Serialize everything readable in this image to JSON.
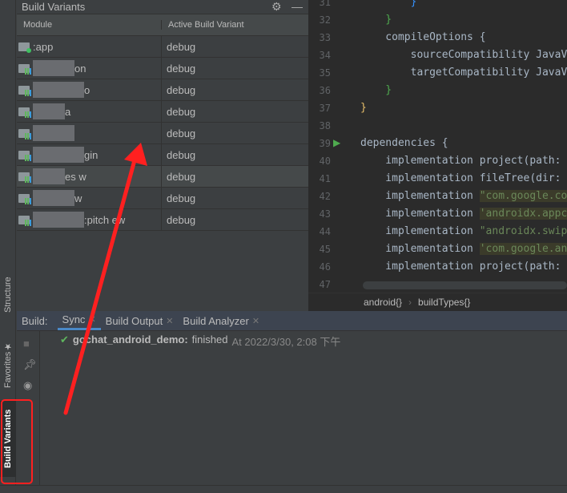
{
  "left_strip": {
    "structure": "Structure",
    "favorites": "Favorites",
    "build_variants": "Build Variants"
  },
  "build_variants": {
    "title": "Build Variants",
    "columns": [
      "Module",
      "Active Build Variant"
    ],
    "rows": [
      {
        "module": ":app",
        "variant": "debug",
        "icon": "app-module"
      },
      {
        "module": "on",
        "variant": "debug",
        "icon": "library-module"
      },
      {
        "module": "o",
        "variant": "debug",
        "icon": "library-module"
      },
      {
        "module": "a",
        "variant": "debug",
        "icon": "library-module"
      },
      {
        "module": "",
        "variant": "debug",
        "icon": "library-module"
      },
      {
        "module": "gin",
        "variant": "debug",
        "icon": "library-module"
      },
      {
        "module": "es w",
        "variant": "debug",
        "icon": "library-module"
      },
      {
        "module": "w",
        "variant": "debug",
        "icon": "library-module"
      },
      {
        "module": ":pitch ew",
        "variant": "debug",
        "icon": "library-module"
      }
    ]
  },
  "editor": {
    "line_numbers": [
      "31",
      "32",
      "33",
      "34",
      "35",
      "36",
      "37",
      "38",
      "39",
      "40",
      "41",
      "42",
      "43",
      "44",
      "45",
      "46",
      "47"
    ],
    "lines": [
      {
        "t": "        }",
        "c": "bb"
      },
      {
        "t": "    }",
        "c": "bg"
      },
      {
        "t": "    compileOptions {"
      },
      {
        "t": "        sourceCompatibility JavaV"
      },
      {
        "t": "        targetCompatibility JavaV"
      },
      {
        "t": "    }",
        "c": "bg"
      },
      {
        "t": "}",
        "c": "br"
      },
      {
        "t": ""
      },
      {
        "t": "dependencies {"
      },
      {
        "t": "    implementation project(path:"
      },
      {
        "t": "    implementation fileTree(dir:"
      },
      {
        "t": "    implementation ",
        "s": "\"com.google.co",
        "h": true
      },
      {
        "t": "    implementation ",
        "s": "'androidx.appc",
        "h": true
      },
      {
        "t": "    implementation ",
        "s": "\"androidx.swip"
      },
      {
        "t": "    implementation ",
        "s": "'com.google.an",
        "h": true
      },
      {
        "t": "    implementation project(path:"
      },
      {
        "t": ""
      }
    ],
    "breadcrumb": [
      "android{}",
      "buildTypes{}"
    ]
  },
  "build": {
    "label": "Build:",
    "tabs": [
      "Sync",
      "Build Output",
      "Build Analyzer"
    ],
    "active_tab": "Sync",
    "project": "gochat_android_demo:",
    "status": "finished",
    "time": "At 2022/3/30, 2:08 下午"
  },
  "annotation_color": "#ff2020"
}
